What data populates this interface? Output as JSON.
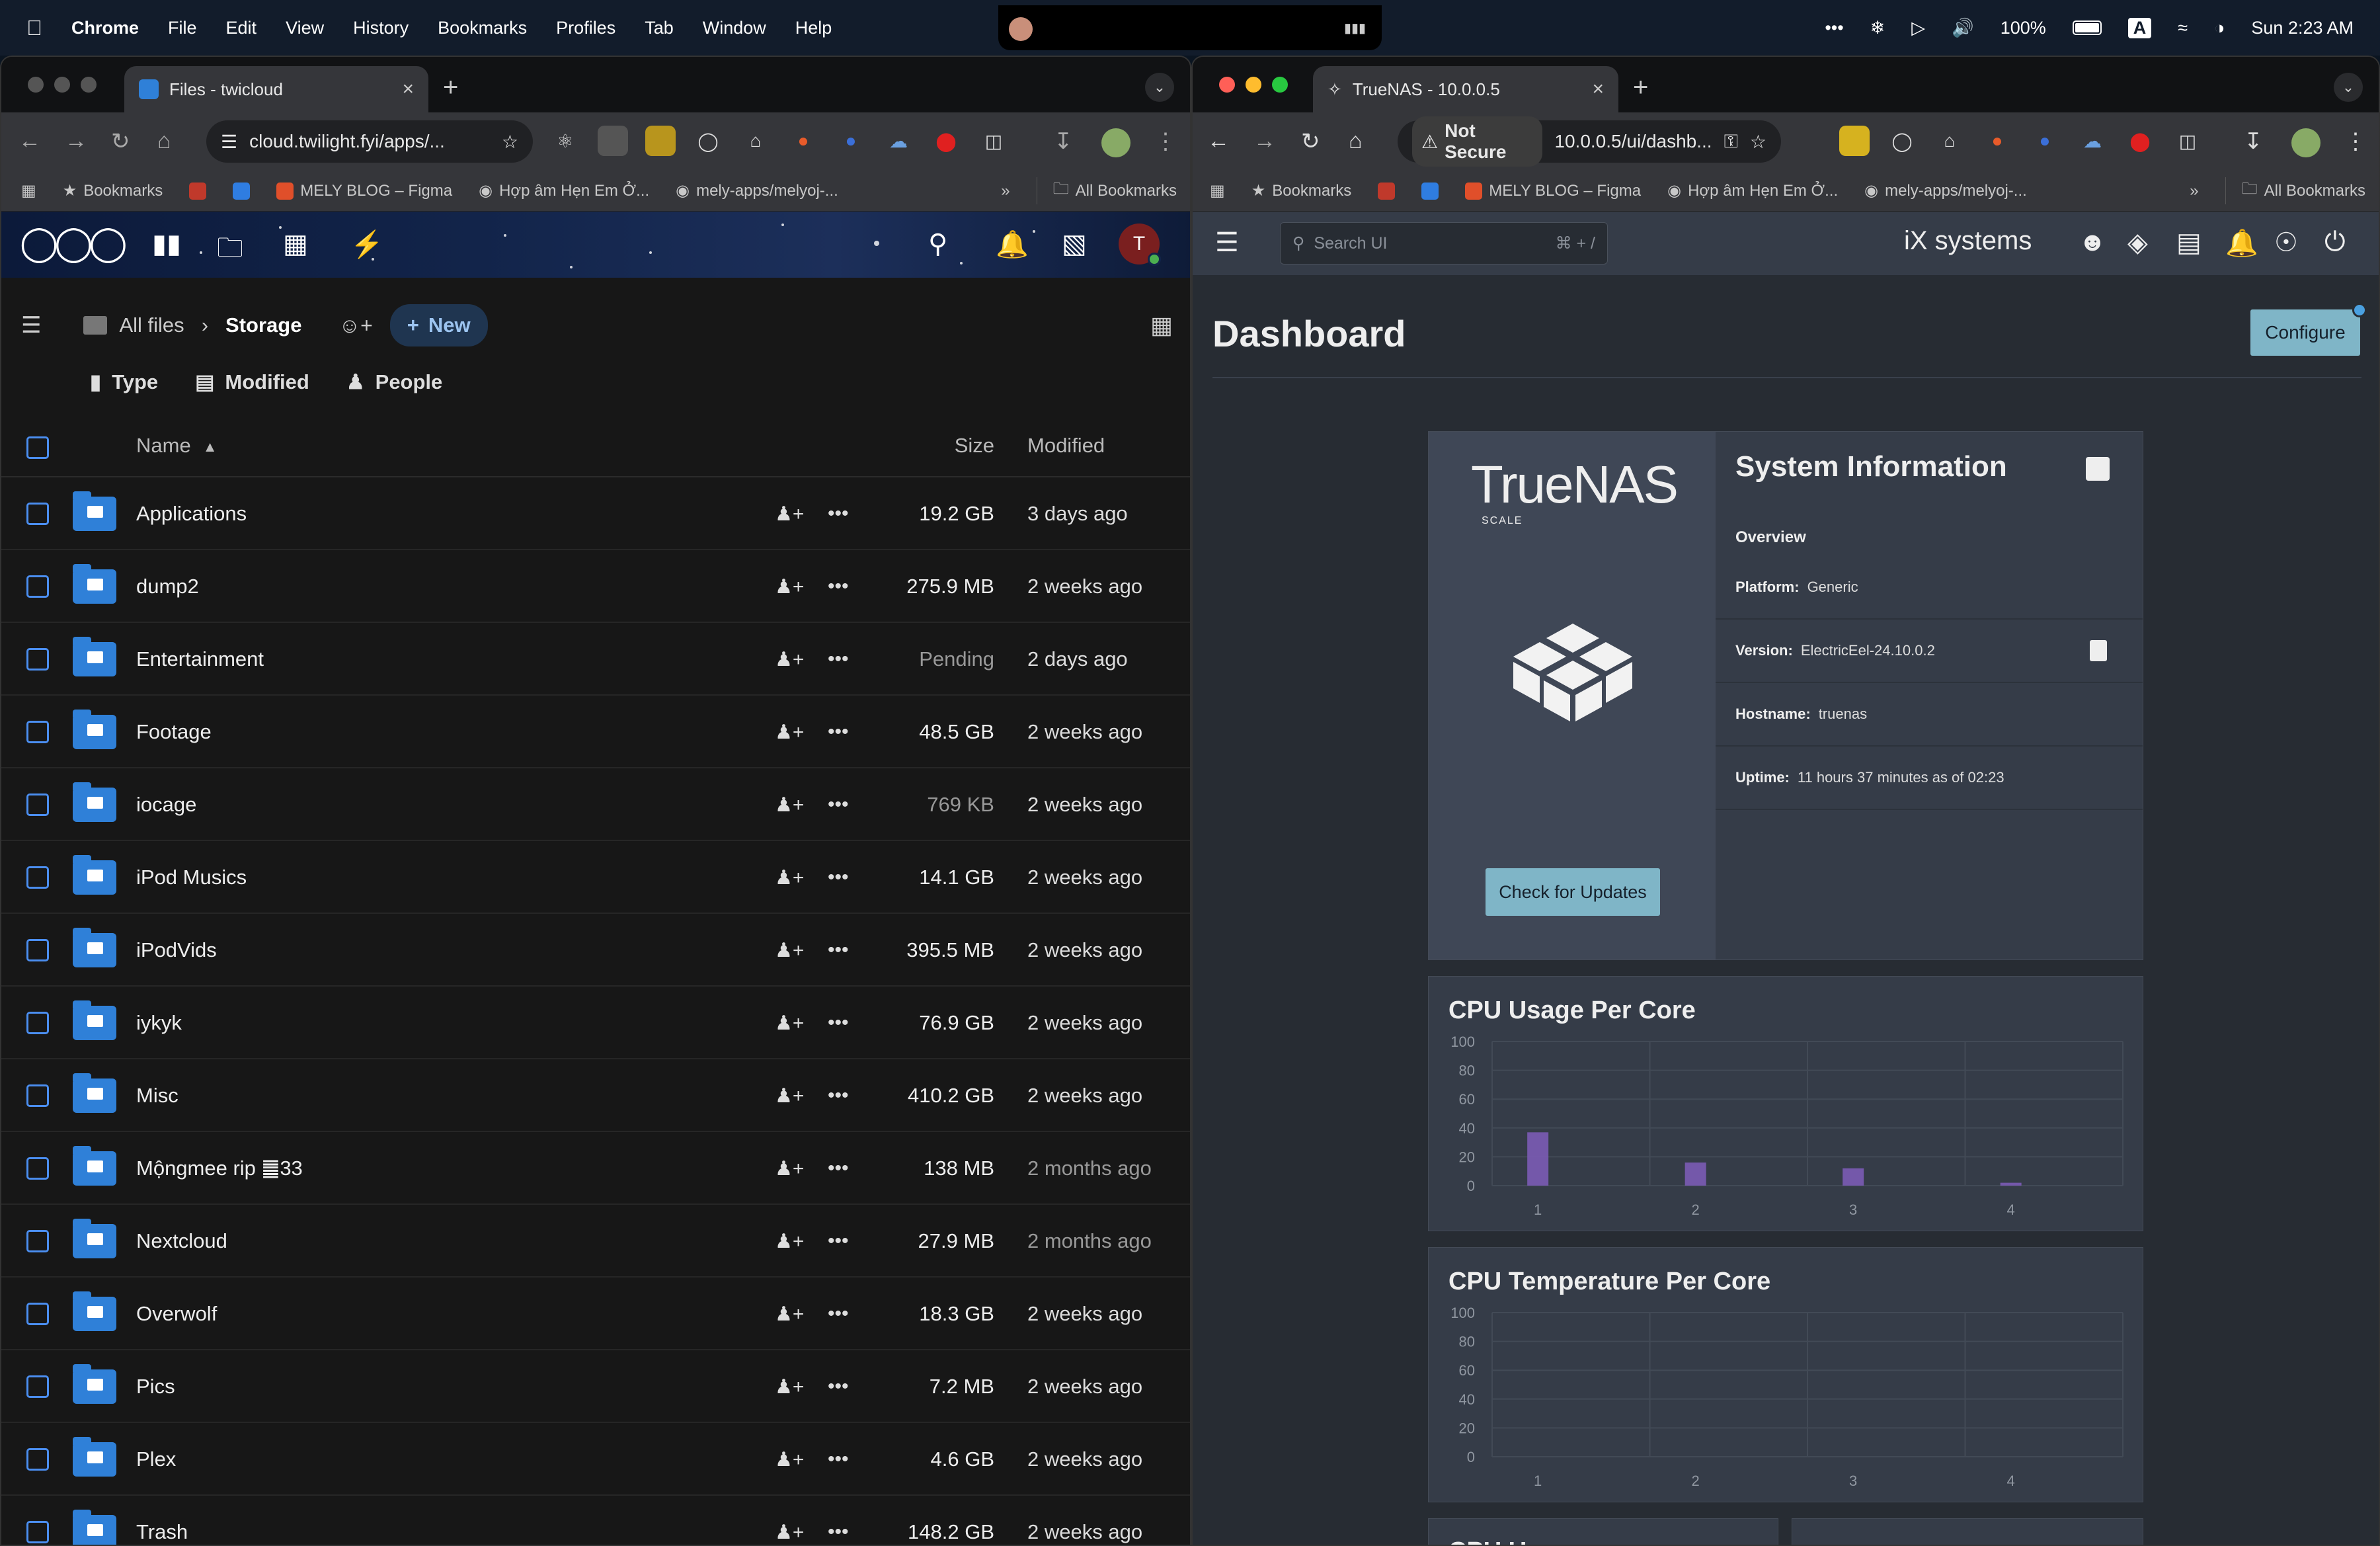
{
  "menubar": {
    "app": "Chrome",
    "items": [
      "File",
      "Edit",
      "View",
      "History",
      "Bookmarks",
      "Profiles",
      "Tab",
      "Window",
      "Help"
    ],
    "battery": "100%",
    "input_source": "A",
    "clock": "Sun 2:23 AM"
  },
  "left_browser": {
    "tab_title": "Files - twicloud",
    "url": "cloud.twilight.fyi/apps/...",
    "bookmarks": [
      "Bookmarks",
      "MELY BLOG – Figma",
      "Hợp âm Hẹn Em Ở...",
      "mely-apps/melyoj-..."
    ],
    "all_bookmarks": "All Bookmarks"
  },
  "nextcloud": {
    "breadcrumb_root": "All files",
    "breadcrumb_current": "Storage",
    "new_button": "New",
    "filters": [
      "Type",
      "Modified",
      "People"
    ],
    "columns": {
      "name": "Name",
      "size": "Size",
      "modified": "Modified"
    },
    "user_initial": "T",
    "files": [
      {
        "name": "Applications",
        "size": "19.2 GB",
        "modified": "3 days ago"
      },
      {
        "name": "dump2",
        "size": "275.9 MB",
        "modified": "2 weeks ago"
      },
      {
        "name": "Entertainment",
        "size": "Pending",
        "modified": "2 days ago"
      },
      {
        "name": "Footage",
        "size": "48.5 GB",
        "modified": "2 weeks ago"
      },
      {
        "name": "iocage",
        "size": "769 KB",
        "modified": "2 weeks ago"
      },
      {
        "name": "iPod Musics",
        "size": "14.1 GB",
        "modified": "2 weeks ago"
      },
      {
        "name": "iPodVids",
        "size": "395.5 MB",
        "modified": "2 weeks ago"
      },
      {
        "name": "iykyk",
        "size": "76.9 GB",
        "modified": "2 weeks ago"
      },
      {
        "name": "Misc",
        "size": "410.2 GB",
        "modified": "2 weeks ago"
      },
      {
        "name": "Mộngmee rip ䷀33",
        "size": "138 MB",
        "modified": "2 months ago"
      },
      {
        "name": "Nextcloud",
        "size": "27.9 MB",
        "modified": "2 months ago"
      },
      {
        "name": "Overwolf",
        "size": "18.3 GB",
        "modified": "2 weeks ago"
      },
      {
        "name": "Pics",
        "size": "7.2 MB",
        "modified": "2 weeks ago"
      },
      {
        "name": "Plex",
        "size": "4.6 GB",
        "modified": "2 weeks ago"
      },
      {
        "name": "Trash",
        "size": "148.2 GB",
        "modified": "2 weeks ago"
      }
    ]
  },
  "right_browser": {
    "tab_title": "TrueNAS - 10.0.0.5",
    "security": "Not Secure",
    "url": "10.0.0.5/ui/dashb...",
    "bookmarks": [
      "Bookmarks",
      "MELY BLOG – Figma",
      "Hợp âm Hẹn Em Ở...",
      "mely-apps/melyoj-..."
    ],
    "all_bookmarks": "All Bookmarks"
  },
  "truenas": {
    "search_placeholder": "Search UI",
    "search_shortcut": "⌘ + /",
    "brand": "iX systems",
    "page_title": "Dashboard",
    "configure_button": "Configure",
    "logo_text": "TrueNAS",
    "logo_sub": "SCALE",
    "sysinfo": {
      "title": "System Information",
      "overview": "Overview",
      "platform_label": "Platform:",
      "platform": "Generic",
      "version_label": "Version:",
      "version": "ElectricEel-24.10.0.2",
      "hostname_label": "Hostname:",
      "hostname": "truenas",
      "uptime_label": "Uptime:",
      "uptime": "11 hours 37 minutes as of 02:23",
      "update_button": "Check for Updates"
    },
    "next_card_partial": "CPU U"
  },
  "colors": {
    "folder": "#2f80d8",
    "checkbox": "#4b8ef0",
    "bar": "#7b5bb5",
    "accent": "#7fb5c7"
  },
  "chart_data": [
    {
      "type": "bar",
      "title": "CPU Usage Per Core",
      "categories": [
        "1",
        "2",
        "3",
        "4"
      ],
      "values": [
        37,
        16,
        12,
        2
      ],
      "yticks": [
        0,
        20,
        40,
        60,
        80,
        100
      ],
      "ylim": [
        0,
        100
      ],
      "grid": true
    },
    {
      "type": "bar",
      "title": "CPU Temperature Per Core",
      "categories": [
        "1",
        "2",
        "3",
        "4"
      ],
      "values": [
        0,
        0,
        0,
        0
      ],
      "yticks": [
        0,
        20,
        40,
        60,
        80,
        100
      ],
      "ylim": [
        0,
        100
      ],
      "grid": true
    }
  ]
}
